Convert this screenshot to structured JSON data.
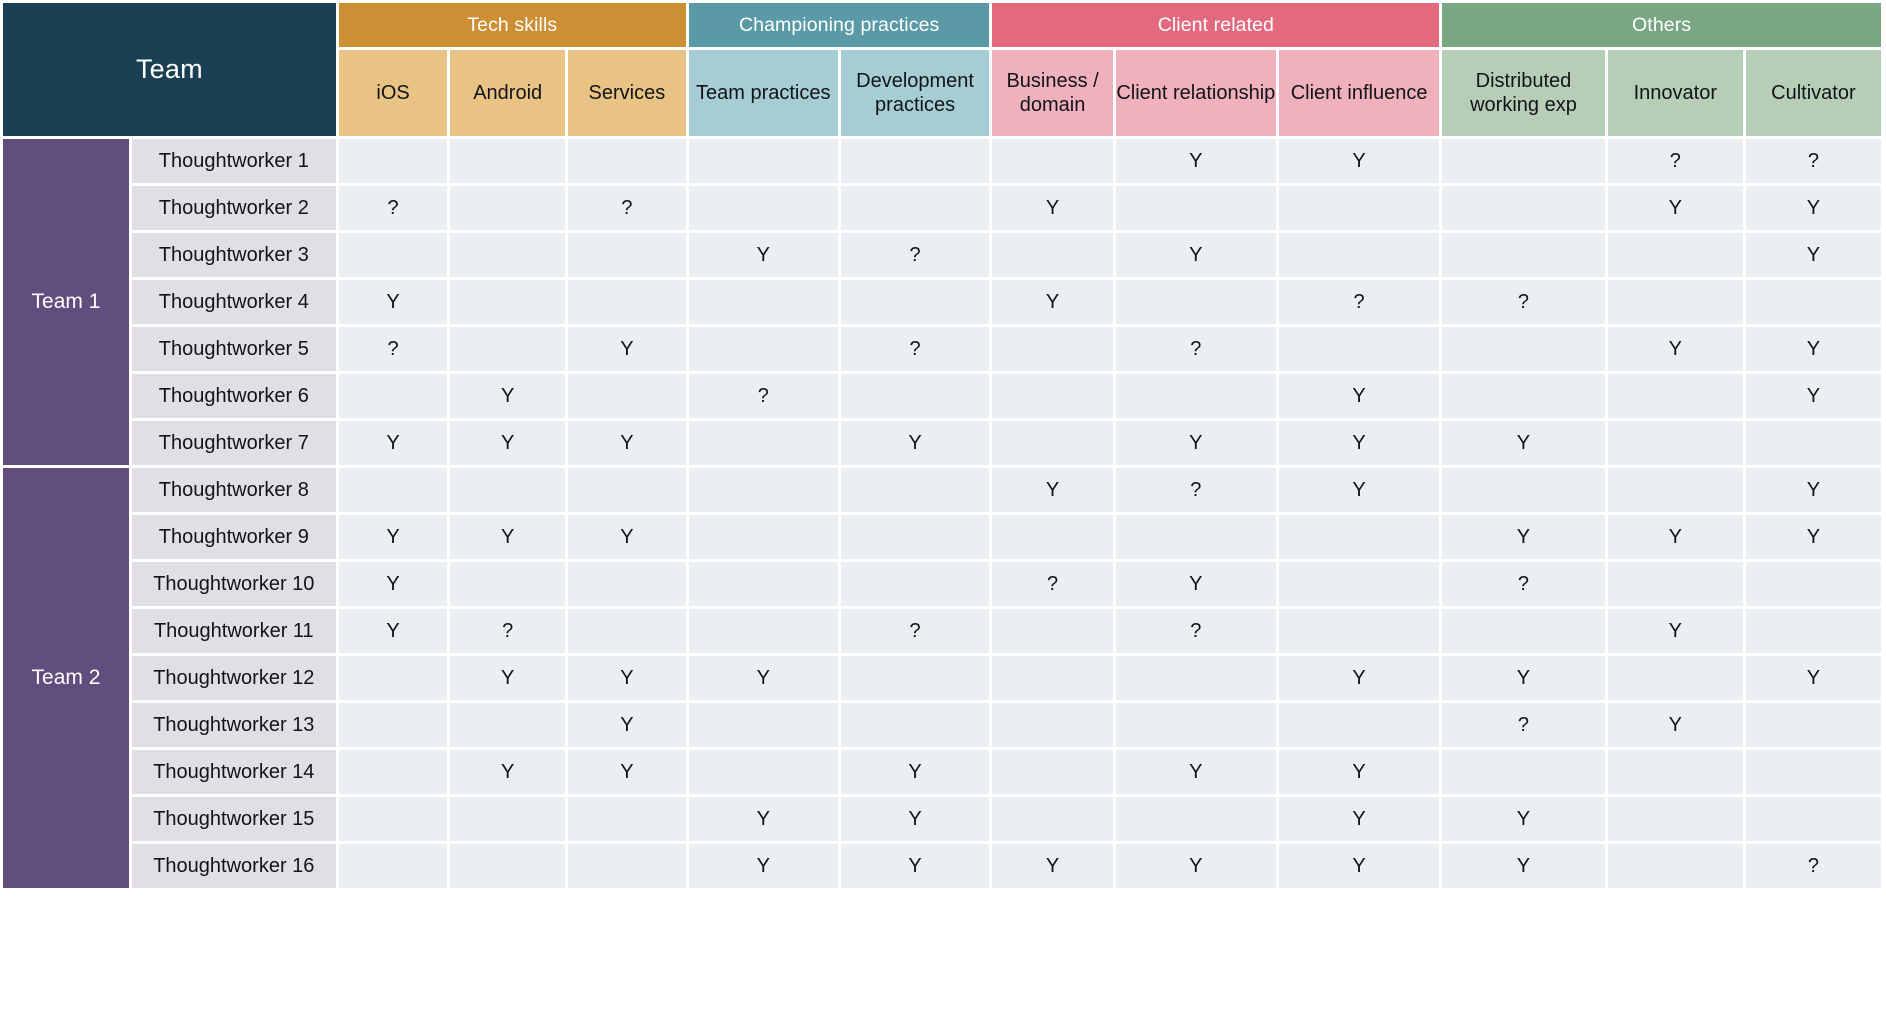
{
  "table": {
    "corner_label": "Team",
    "column_groups": [
      {
        "label": "Tech skills",
        "color": "#cd8f33",
        "span": 3
      },
      {
        "label": "Championing practices",
        "color": "#599aa6",
        "span": 2
      },
      {
        "label": "Client related",
        "color": "#e3697f",
        "span": 3
      },
      {
        "label": "Others",
        "color": "#7aa683",
        "span": 3
      }
    ],
    "columns": [
      {
        "label": "iOS",
        "group": "Tech skills"
      },
      {
        "label": "Android",
        "group": "Tech skills"
      },
      {
        "label": "Services",
        "group": "Tech skills"
      },
      {
        "label": "Team practices",
        "group": "Championing practices"
      },
      {
        "label": "Development practices",
        "group": "Championing practices"
      },
      {
        "label": "Business / domain",
        "group": "Client related"
      },
      {
        "label": "Client relationship",
        "group": "Client related"
      },
      {
        "label": "Client influence",
        "group": "Client related"
      },
      {
        "label": "Distributed working exp",
        "group": "Others"
      },
      {
        "label": "Innovator",
        "group": "Others"
      },
      {
        "label": "Cultivator",
        "group": "Others"
      }
    ],
    "teams": [
      {
        "label": "Team 1",
        "row_count": 7
      },
      {
        "label": "Team 2",
        "row_count": 9
      }
    ],
    "rows": [
      {
        "team": "Team 1",
        "name": "Thoughtworker 1",
        "values": [
          "",
          "",
          "",
          "",
          "",
          "",
          "Y",
          "Y",
          "",
          "?",
          "?"
        ]
      },
      {
        "team": "Team 1",
        "name": "Thoughtworker 2",
        "values": [
          "?",
          "",
          "?",
          "",
          "",
          "Y",
          "",
          "",
          "",
          "Y",
          "Y"
        ]
      },
      {
        "team": "Team 1",
        "name": "Thoughtworker 3",
        "values": [
          "",
          "",
          "",
          "Y",
          "?",
          "",
          "Y",
          "",
          "",
          "",
          "Y"
        ]
      },
      {
        "team": "Team 1",
        "name": "Thoughtworker 4",
        "values": [
          "Y",
          "",
          "",
          "",
          "",
          "Y",
          "",
          "?",
          "?",
          "",
          ""
        ]
      },
      {
        "team": "Team 1",
        "name": "Thoughtworker 5",
        "values": [
          "?",
          "",
          "Y",
          "",
          "?",
          "",
          "?",
          "",
          "",
          "Y",
          "Y"
        ]
      },
      {
        "team": "Team 1",
        "name": "Thoughtworker 6",
        "values": [
          "",
          "Y",
          "",
          "?",
          "",
          "",
          "",
          "Y",
          "",
          "",
          "Y"
        ]
      },
      {
        "team": "Team 1",
        "name": "Thoughtworker 7",
        "values": [
          "Y",
          "Y",
          "Y",
          "",
          "Y",
          "",
          "Y",
          "Y",
          "Y",
          "",
          ""
        ]
      },
      {
        "team": "Team 2",
        "name": "Thoughtworker 8",
        "values": [
          "",
          "",
          "",
          "",
          "",
          "Y",
          "?",
          "Y",
          "",
          "",
          "Y"
        ]
      },
      {
        "team": "Team 2",
        "name": "Thoughtworker 9",
        "values": [
          "Y",
          "Y",
          "Y",
          "",
          "",
          "",
          "",
          "",
          "Y",
          "Y",
          "Y"
        ]
      },
      {
        "team": "Team 2",
        "name": "Thoughtworker 10",
        "values": [
          "Y",
          "",
          "",
          "",
          "",
          "?",
          "Y",
          "",
          "?",
          "",
          ""
        ]
      },
      {
        "team": "Team 2",
        "name": "Thoughtworker 11",
        "values": [
          "Y",
          "?",
          "",
          "",
          "?",
          "",
          "?",
          "",
          "",
          "Y",
          ""
        ]
      },
      {
        "team": "Team 2",
        "name": "Thoughtworker 12",
        "values": [
          "",
          "Y",
          "Y",
          "Y",
          "",
          "",
          "",
          "Y",
          "Y",
          "",
          "Y"
        ]
      },
      {
        "team": "Team 2",
        "name": "Thoughtworker 13",
        "values": [
          "",
          "",
          "Y",
          "",
          "",
          "",
          "",
          "",
          "?",
          "Y",
          ""
        ]
      },
      {
        "team": "Team 2",
        "name": "Thoughtworker 14",
        "values": [
          "",
          "Y",
          "Y",
          "",
          "Y",
          "",
          "Y",
          "Y",
          "",
          "",
          ""
        ]
      },
      {
        "team": "Team 2",
        "name": "Thoughtworker 15",
        "values": [
          "",
          "",
          "",
          "Y",
          "Y",
          "",
          "",
          "Y",
          "Y",
          "",
          ""
        ]
      },
      {
        "team": "Team 2",
        "name": "Thoughtworker 16",
        "values": [
          "",
          "",
          "",
          "Y",
          "Y",
          "Y",
          "Y",
          "Y",
          "Y",
          "",
          "?"
        ]
      }
    ]
  }
}
